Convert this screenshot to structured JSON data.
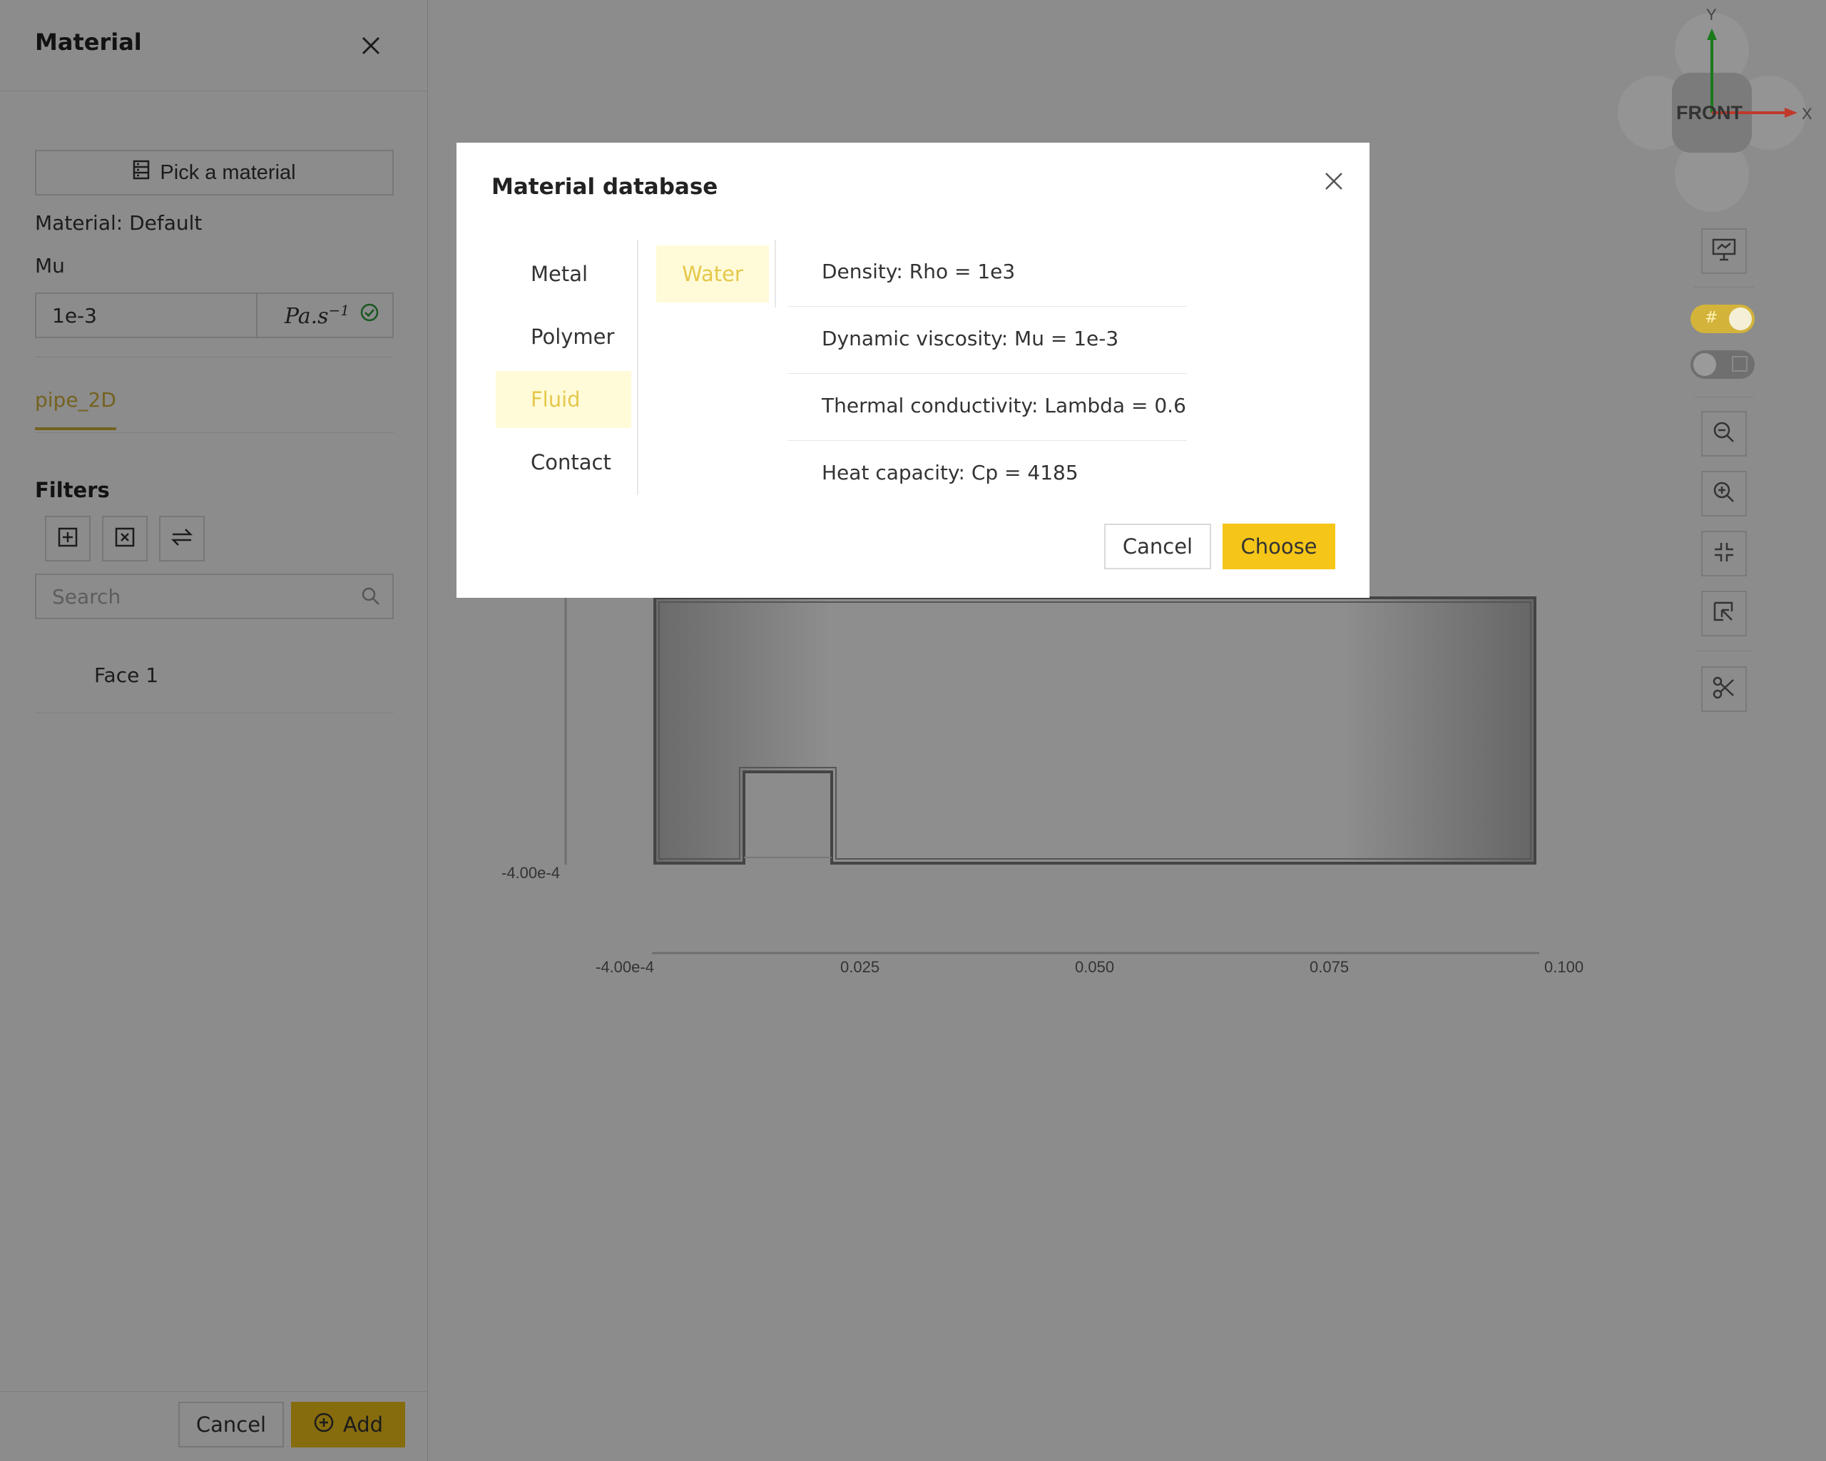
{
  "panel": {
    "title": "Material",
    "pick_button_label": "Pick a material",
    "material_text": "Material: Default",
    "mu_label": "Mu",
    "mu_value": "1e-3",
    "mu_unit_base": "Pa.s",
    "mu_unit_exp": "−1",
    "tab_label": "pipe_2D",
    "filters_label": "Filters",
    "search_placeholder": "Search",
    "face_item": "Face 1",
    "cancel_label": "Cancel",
    "add_label": "Add"
  },
  "viewer": {
    "axis_y_bottom": "-4.00e-4",
    "axis_x_ticks": [
      "-4.00e-4",
      "0.025",
      "0.050",
      "0.075",
      "0.100"
    ],
    "cube_face": "FRONT",
    "axis_y_name": "Y",
    "axis_x_name": "X",
    "toggles": [
      {
        "name": "grid",
        "on": true
      },
      {
        "name": "other",
        "on": false
      }
    ]
  },
  "modal": {
    "title": "Material database",
    "categories": [
      "Metal",
      "Polymer",
      "Fluid",
      "Contact"
    ],
    "active_category": "Fluid",
    "materials": [
      "Water"
    ],
    "properties": [
      "Density: Rho = 1e3",
      "Dynamic viscosity: Mu = 1e-3",
      "Thermal conductivity: Lambda = 0.6",
      "Heat capacity: Cp = 4185"
    ],
    "cancel_label": "Cancel",
    "choose_label": "Choose"
  },
  "colors": {
    "accent": "#f5c518",
    "accent_text": "#d3b33a",
    "active_bg": "#fffbd8",
    "viewer_bg": "#8c8c8c"
  }
}
